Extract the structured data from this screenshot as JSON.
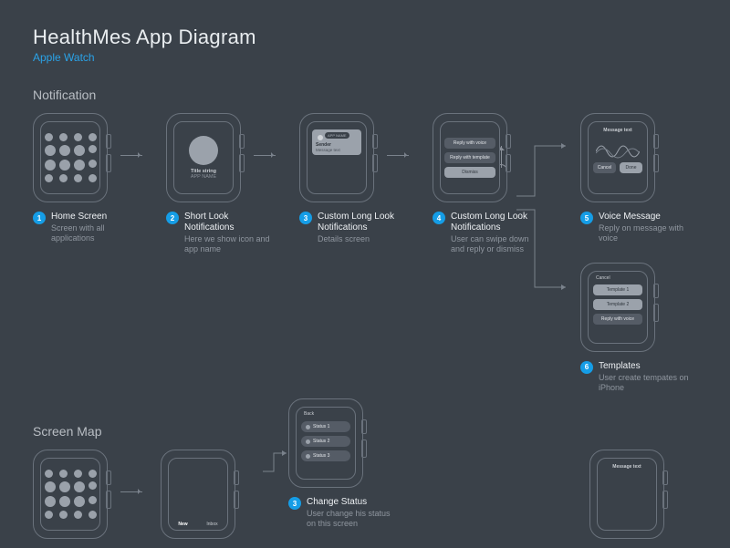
{
  "header": {
    "title": "HealthMes  App Diagram",
    "subtitle": "Apple Watch"
  },
  "sections": {
    "notification": "Notification",
    "screen_map": "Screen Map"
  },
  "steps": {
    "s1": {
      "num": "1",
      "title": "Home Screen",
      "desc": "Screen with all applications"
    },
    "s2": {
      "num": "2",
      "title": "Short Look Notifications",
      "desc": "Here we show icon and app name",
      "screen": {
        "title_string": "Title string",
        "app_name": "APP NAME"
      }
    },
    "s3": {
      "num": "3",
      "title": "Custom Long Look Notifications",
      "desc": "Details screen",
      "screen": {
        "pill": "APP NAME",
        "sender": "Sender",
        "text": "Message text"
      }
    },
    "s4": {
      "num": "4",
      "title": "Custom Long Look Notifications",
      "desc": "User can swipe down and reply or dismiss",
      "screen": {
        "b1": "Reply with voice",
        "b2": "Reply with template",
        "b3": "Dismiss"
      }
    },
    "s5": {
      "num": "5",
      "title": "Voice Message",
      "desc": "Reply on message with voice",
      "screen": {
        "label": "Message text",
        "cancel": "Cancel",
        "done": "Done"
      }
    },
    "s6": {
      "num": "6",
      "title": "Templates",
      "desc": "User create tempates on iPhone",
      "screen": {
        "cancel": "Cancel",
        "t1": "Template 1",
        "t2": "Template 2",
        "t3": "Reply with voice"
      }
    },
    "sm3": {
      "num": "3",
      "title": "Change Status",
      "desc": "User change his status on this screen",
      "screen": {
        "back": "Back",
        "s1": "Status 1",
        "s2": "Status 2",
        "s3": "Status 3"
      }
    },
    "sm_tabs": {
      "new": "New",
      "inbox": "Inbox"
    },
    "sm_right": {
      "label": "Message text"
    }
  }
}
